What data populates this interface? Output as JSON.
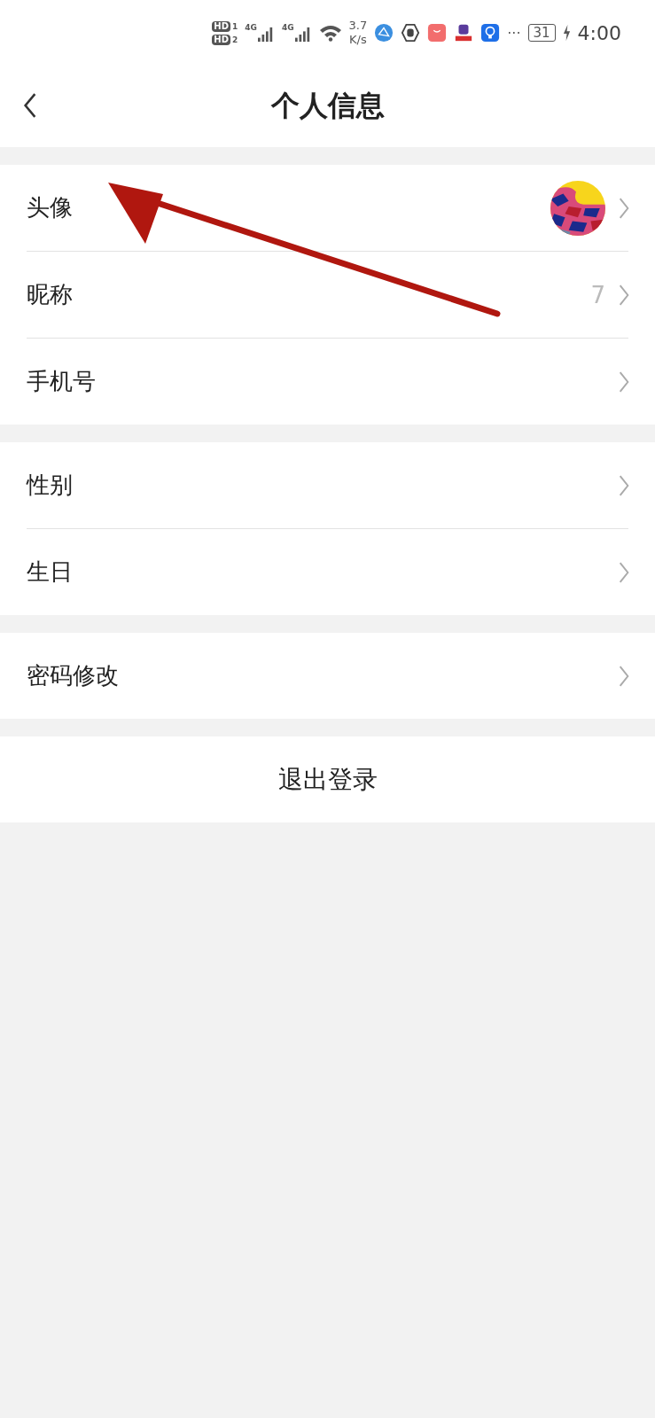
{
  "status_bar": {
    "sims": [
      {
        "badge": "HD",
        "slot": "1"
      },
      {
        "badge": "HD",
        "slot": "2"
      }
    ],
    "networks": [
      "4G",
      "4G"
    ],
    "speed_value": "3.7",
    "speed_unit": "K/s",
    "more": "···",
    "battery": "31",
    "charging": true,
    "time": "4:00"
  },
  "header": {
    "title": "个人信息"
  },
  "groups": [
    {
      "items": [
        {
          "kind": "avatar",
          "label": "头像"
        },
        {
          "kind": "text",
          "label": "昵称",
          "value": "7"
        },
        {
          "kind": "text",
          "label": "手机号"
        }
      ]
    },
    {
      "items": [
        {
          "kind": "text",
          "label": "性别"
        },
        {
          "kind": "text",
          "label": "生日"
        }
      ]
    },
    {
      "items": [
        {
          "kind": "text",
          "label": "密码修改"
        }
      ]
    }
  ],
  "logout": "退出登录",
  "annotation": {
    "kind": "arrow"
  }
}
